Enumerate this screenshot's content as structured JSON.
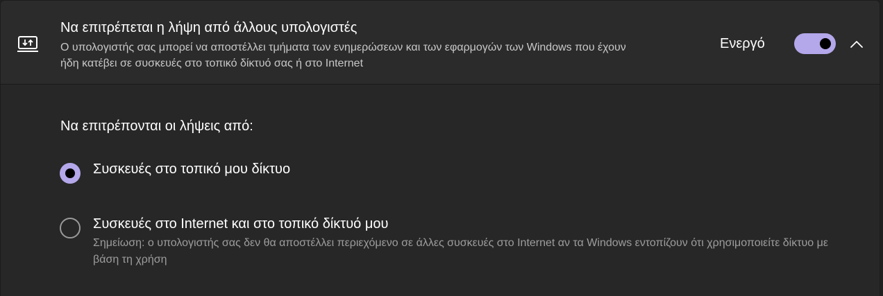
{
  "header": {
    "icon": "download-transfer-icon",
    "title": "Να επιτρέπεται η λήψη από άλλους υπολογιστές",
    "description": "Ο υπολογιστής σας μπορεί να αποστέλλει τμήματα των ενημερώσεων και των εφαρμογών των Windows που έχουν ήδη κατέβει σε συσκευές στο τοπικό δίκτυό σας ή στο Internet",
    "status_label": "Ενεργό",
    "toggle_on": true,
    "expanded": true
  },
  "content": {
    "section_label": "Να επιτρέπονται οι λήψεις από:",
    "options": [
      {
        "label": "Συσκευές στο τοπικό μου δίκτυο",
        "selected": true,
        "note": ""
      },
      {
        "label": "Συσκευές στο Internet και στο τοπικό δίκτυό μου",
        "selected": false,
        "note": "Σημείωση: ο υπολογιστής σας δεν θα αποστέλλει περιεχόμενο σε άλλες συσκευές στο Internet αν τα Windows εντοπίζουν ότι χρησιμοποιείτε δίκτυο με βάση τη χρήση"
      }
    ]
  },
  "colors": {
    "accent": "#b4a7ea",
    "header_bg": "#2b2b2b",
    "content_bg": "#272727",
    "secondary_text": "#c8c8c8",
    "note_text": "#9d9d9d"
  }
}
